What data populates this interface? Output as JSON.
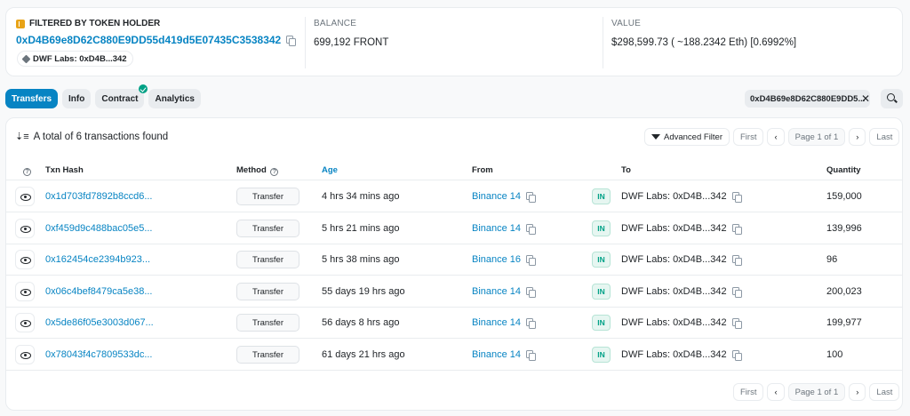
{
  "holder": {
    "label": "FILTERED BY TOKEN HOLDER",
    "address": "0xD4B69e8D62C880E9DD55d419d5E07435C3538342",
    "tag": "DWF Labs: 0xD4B...342"
  },
  "balance": {
    "label": "BALANCE",
    "value": "699,192 FRONT"
  },
  "value": {
    "label": "VALUE",
    "value": "$298,599.73 ( ~188.2342 Eth) [0.6992%]"
  },
  "tabs": [
    "Transfers",
    "Info",
    "Contract",
    "Analytics"
  ],
  "filter_chip": "0xD4B69e8D62C880E9DD5...",
  "total_text": "A total of 6 transactions found",
  "advanced_filter": "Advanced Filter",
  "pager": {
    "first": "First",
    "prev": "‹",
    "page": "Page 1 of 1",
    "next": "›",
    "last": "Last"
  },
  "columns": {
    "hash": "Txn Hash",
    "method": "Method",
    "age": "Age",
    "from": "From",
    "to": "To",
    "quantity": "Quantity"
  },
  "rows": [
    {
      "hash": "0x1d703fd7892b8ccd6...",
      "method": "Transfer",
      "age": "4 hrs 34 mins ago",
      "from": "Binance 14",
      "dir": "IN",
      "to": "DWF Labs: 0xD4B...342",
      "qty": "159,000"
    },
    {
      "hash": "0xf459d9c488bac05e5...",
      "method": "Transfer",
      "age": "5 hrs 21 mins ago",
      "from": "Binance 14",
      "dir": "IN",
      "to": "DWF Labs: 0xD4B...342",
      "qty": "139,996"
    },
    {
      "hash": "0x162454ce2394b923...",
      "method": "Transfer",
      "age": "5 hrs 38 mins ago",
      "from": "Binance 16",
      "dir": "IN",
      "to": "DWF Labs: 0xD4B...342",
      "qty": "96"
    },
    {
      "hash": "0x06c4bef8479ca5e38...",
      "method": "Transfer",
      "age": "55 days 19 hrs ago",
      "from": "Binance 14",
      "dir": "IN",
      "to": "DWF Labs: 0xD4B...342",
      "qty": "200,023"
    },
    {
      "hash": "0x5de86f05e3003d067...",
      "method": "Transfer",
      "age": "56 days 8 hrs ago",
      "from": "Binance 14",
      "dir": "IN",
      "to": "DWF Labs: 0xD4B...342",
      "qty": "199,977"
    },
    {
      "hash": "0x78043f4c7809533dc...",
      "method": "Transfer",
      "age": "61 days 21 hrs ago",
      "from": "Binance 14",
      "dir": "IN",
      "to": "DWF Labs: 0xD4B...342",
      "qty": "100"
    }
  ]
}
